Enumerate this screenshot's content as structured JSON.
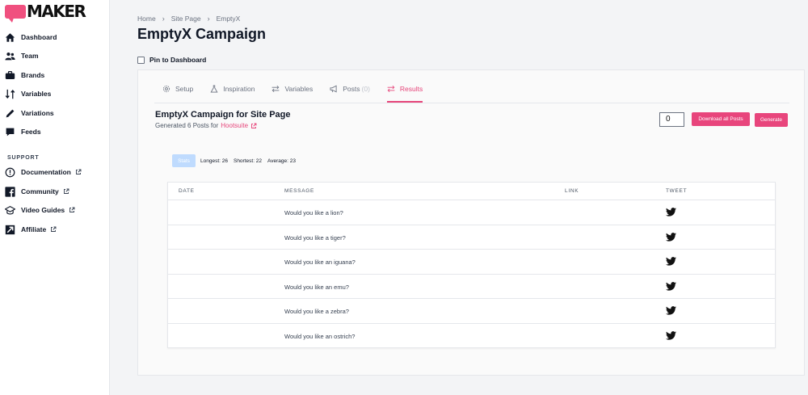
{
  "app": {
    "logo_text": "MAKER",
    "brand_color": "#f0507f"
  },
  "sidebar": {
    "items": [
      {
        "label": "Dashboard",
        "icon": "home-icon"
      },
      {
        "label": "Team",
        "icon": "team-icon"
      },
      {
        "label": "Brands",
        "icon": "briefcase-icon"
      },
      {
        "label": "Variables",
        "icon": "swap-arrows-icon"
      },
      {
        "label": "Variations",
        "icon": "pencil-icon"
      },
      {
        "label": "Feeds",
        "icon": "chat-bubble-icon"
      }
    ],
    "support_label": "SUPPORT",
    "support_items": [
      {
        "label": "Documentation",
        "icon": "info-circle-icon"
      },
      {
        "label": "Community",
        "icon": "facebook-icon"
      },
      {
        "label": "Video Guides",
        "icon": "graduation-cap-icon"
      },
      {
        "label": "Affiliate",
        "icon": "affiliate-icon"
      }
    ]
  },
  "breadcrumb": [
    "Home",
    "Site Page",
    "EmptyX"
  ],
  "page": {
    "title": "EmptyX Campaign",
    "pin_label": "Pin to Dashboard"
  },
  "tabs": [
    {
      "label": "Setup",
      "icon": "gear-icon"
    },
    {
      "label": "Inspiration",
      "icon": "flask-icon"
    },
    {
      "label": "Variables",
      "icon": "swap-arrows-icon"
    },
    {
      "label": "Posts",
      "count": "(0)",
      "icon": "megaphone-icon"
    },
    {
      "label": "Results",
      "icon": "swap-arrows-icon",
      "active": true
    }
  ],
  "campaign": {
    "title": "EmptyX Campaign for Site Page",
    "subtitle": "Generated 6 Posts for",
    "platform": "Hootsuite",
    "count_value": "0",
    "download_label": "Download all Posts",
    "generate_label": "Generate"
  },
  "stats": {
    "button_label": "Stats",
    "longest": "Longest: 26",
    "shortest": "Shortest: 22",
    "average": "Average: 23"
  },
  "table": {
    "headers": [
      "DATE",
      "MESSAGE",
      "LINK",
      "TWEET"
    ],
    "rows": [
      "Would you like a lion?",
      "Would you like a tiger?",
      "Would you like an iguana?",
      "Would you like an emu?",
      "Would you like a zebra?",
      "Would you like an ostrich?"
    ]
  }
}
